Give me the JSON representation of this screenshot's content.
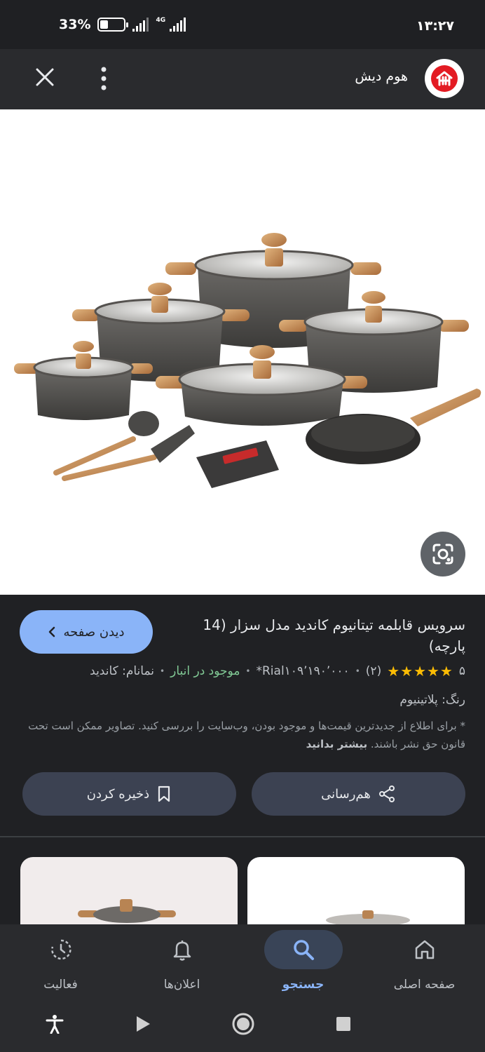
{
  "status_bar": {
    "time": "۱۳:۲۷",
    "battery_percent": "33%",
    "battery_level": 0.33,
    "network": "4G"
  },
  "header": {
    "site_name": "هوم دیش"
  },
  "product": {
    "title": "سرویس قابلمه تیتانیوم کاندید مدل سزار (14 پارچه)",
    "visit_label": "دیدن صفحه",
    "rating": "۵",
    "rating_value": 5,
    "review_count": "(۲)",
    "price": "*Rial۱۰۹٬۱۹۰٬۰۰۰",
    "stock": "موجود در انبار",
    "brand": "نمانام: کاندید",
    "color": "رنگ: پلاتینیوم",
    "disclaimer": "* برای اطلاع از جدیدترین قیمت‌ها و موجود بودن، وب‌سایت را بررسی کنید. تصاویر ممکن است تحت قانون حق نشر باشند.",
    "learn_more": "بیشتر بدانید",
    "share_label": "هم‌رسانی",
    "save_label": "ذخیره کردن"
  },
  "bottom_nav": [
    {
      "label": "صفحه اصلی",
      "icon": "home-icon",
      "active": false
    },
    {
      "label": "جستجو",
      "icon": "search-icon",
      "active": true
    },
    {
      "label": "اعلان‌ها",
      "icon": "bell-icon",
      "active": false
    },
    {
      "label": "فعالیت",
      "icon": "activity-icon",
      "active": false
    }
  ],
  "colors": {
    "background": "#202124",
    "accent": "#8ab4f8",
    "stock_green": "#81c995",
    "star": "#fbbc04",
    "button": "#3c4252"
  }
}
